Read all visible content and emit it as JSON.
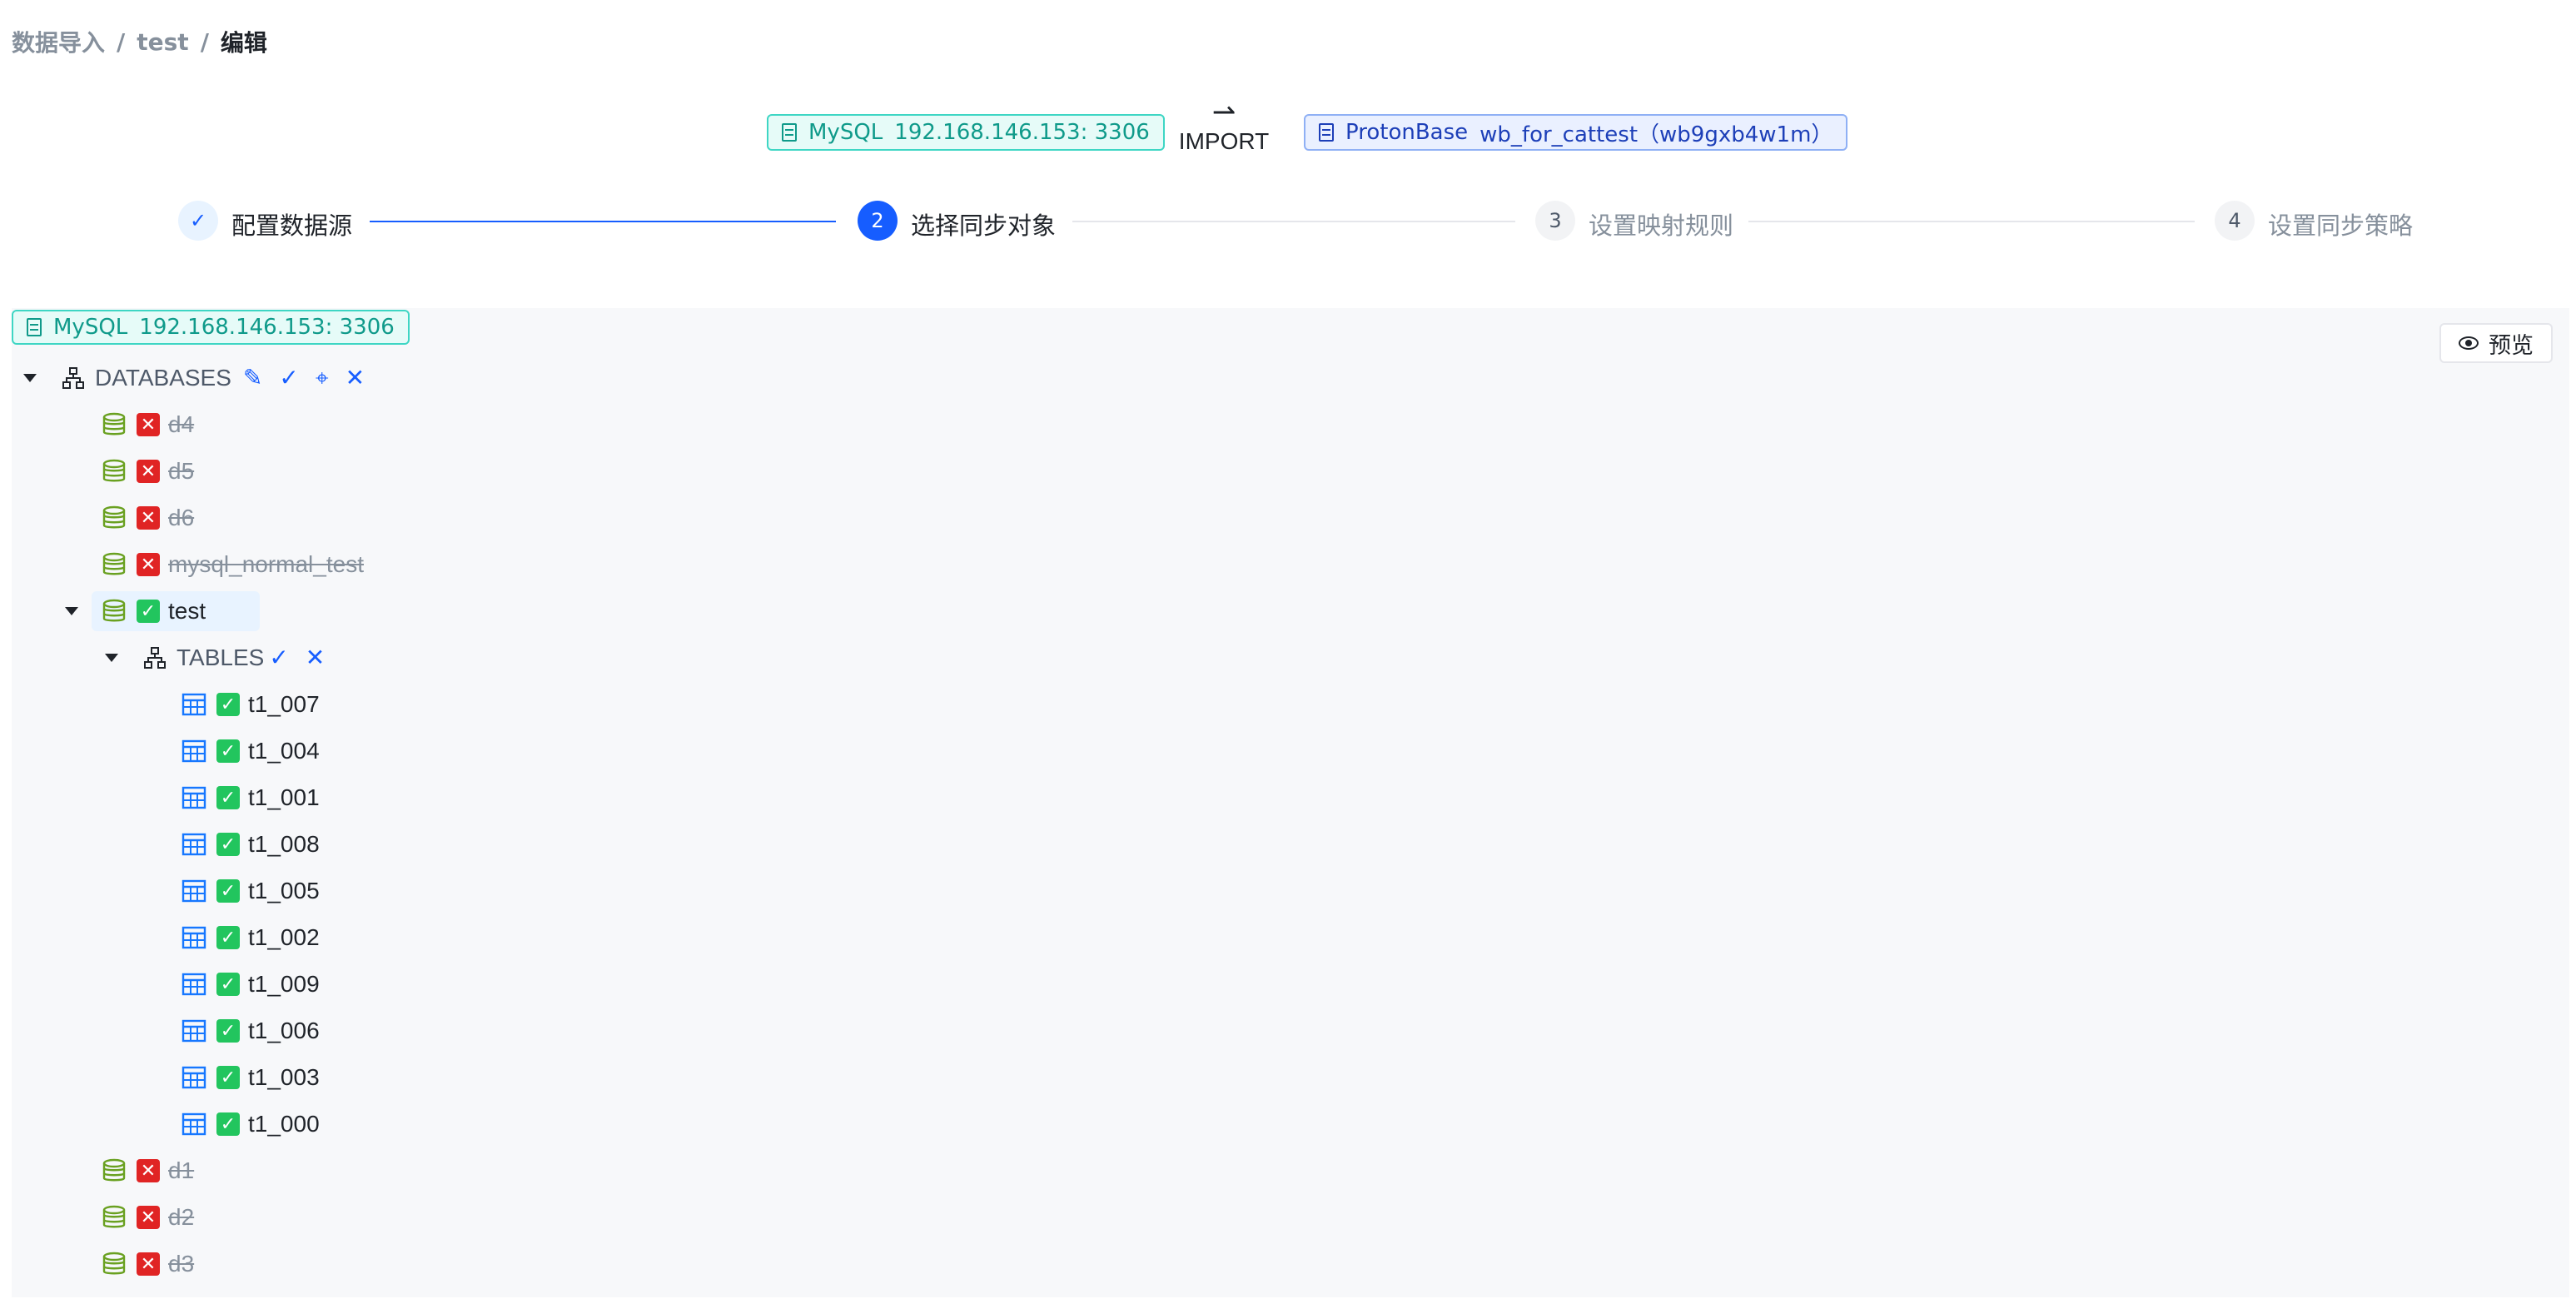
{
  "breadcrumb": {
    "root": "数据导入",
    "sep": "/",
    "mid": "test",
    "current": "编辑"
  },
  "connection": {
    "source": {
      "type": "MySQL",
      "addr": "192.168.146.153: 3306"
    },
    "arrow": "⇀",
    "action": "IMPORT",
    "target": {
      "type": "ProtonBase",
      "name": "wb_for_cattest（wb9gxb4w1m）"
    }
  },
  "steps": [
    {
      "num": "✓",
      "label": "配置数据源",
      "state": "done"
    },
    {
      "num": "2",
      "label": "选择同步对象",
      "state": "active"
    },
    {
      "num": "3",
      "label": "设置映射规则",
      "state": "wait"
    },
    {
      "num": "4",
      "label": "设置同步策略",
      "state": "wait"
    }
  ],
  "panel": {
    "source_tag": {
      "type": "MySQL",
      "addr": "192.168.146.153: 3306"
    },
    "preview_label": "预览"
  },
  "tree": {
    "databases_label": "DATABASES",
    "tables_label": "TABLES",
    "check_glyph": "✓",
    "cross_glyph": "✕",
    "databases_before": [
      {
        "name": "d4",
        "selected": false
      },
      {
        "name": "d5",
        "selected": false
      },
      {
        "name": "d6",
        "selected": false
      },
      {
        "name": "mysql_normal_test",
        "selected": false
      }
    ],
    "expanded_db": {
      "name": "test",
      "selected": true
    },
    "tables": [
      "t1_007",
      "t1_004",
      "t1_001",
      "t1_008",
      "t1_005",
      "t1_002",
      "t1_009",
      "t1_006",
      "t1_003",
      "t1_000"
    ],
    "databases_after": [
      {
        "name": "d1",
        "selected": false
      },
      {
        "name": "d2",
        "selected": false
      },
      {
        "name": "d3",
        "selected": false
      }
    ]
  },
  "colors": {
    "accent": "#165dff",
    "check": "#22c55e",
    "cross": "#e02424",
    "db_icon": "#6aa121",
    "table_icon": "#1677ff"
  }
}
